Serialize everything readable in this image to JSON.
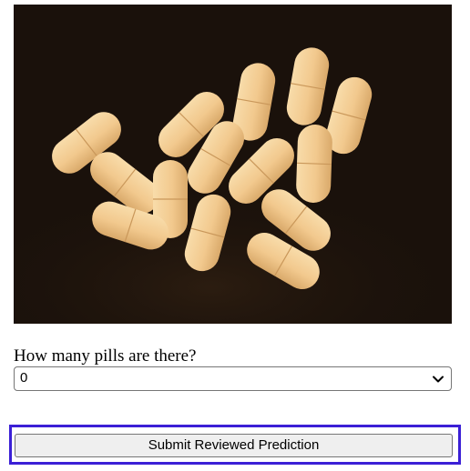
{
  "image": {
    "subject": "pills-photo",
    "pill_count": 15
  },
  "form": {
    "question": "How many pills are there?",
    "selected_value": "0",
    "select_icon": "chevron-down-icon"
  },
  "actions": {
    "submit_label": "Submit Reviewed Prediction"
  },
  "colors": {
    "photo_background": "#1a110b",
    "pill": "#f2c98e",
    "focus_outline": "#3b1fd6"
  }
}
